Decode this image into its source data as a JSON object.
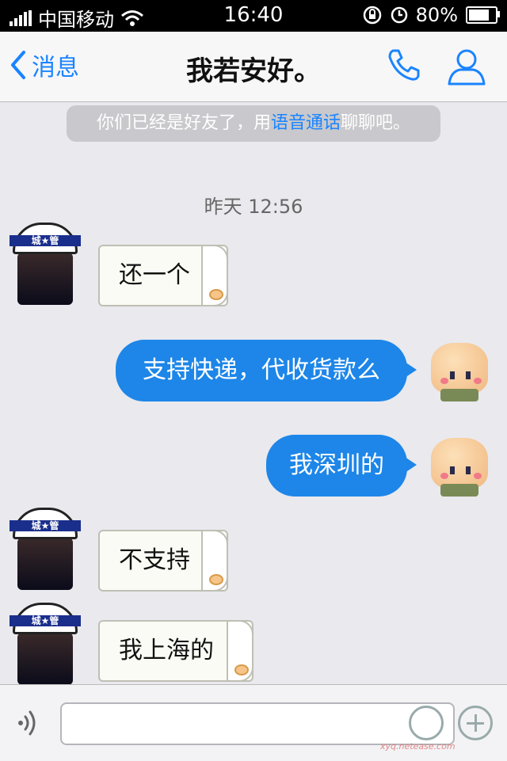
{
  "status_bar": {
    "carrier": "中国移动",
    "time": "16:40",
    "battery": "80%"
  },
  "nav": {
    "back_label": "消息",
    "title": "我若安好。"
  },
  "system_note": {
    "prefix": "你们已经是好友了，用",
    "link": "语音通话",
    "suffix": "聊聊吧。"
  },
  "timestamp": "昨天 12:56",
  "messages": [
    {
      "side": "left",
      "text": "还一个",
      "avatar_text": "城★管"
    },
    {
      "side": "right",
      "text": "支持快递，代收货款么"
    },
    {
      "side": "right",
      "text": "我深圳的"
    },
    {
      "side": "left",
      "text": "不支持",
      "avatar_text": "城★管"
    },
    {
      "side": "left",
      "text": "我上海的",
      "avatar_text": "城★管"
    }
  ],
  "input": {
    "placeholder": ""
  },
  "watermark": {
    "url": "xyq.netease.com"
  },
  "icons": [
    "back-chevron-icon",
    "phone-icon",
    "profile-icon",
    "voice-icon",
    "emoji-icon",
    "plus-icon",
    "wifi-icon",
    "lock-rotation-icon",
    "alarm-icon",
    "battery-icon"
  ],
  "colors": {
    "accent": "#1a84ff",
    "bubble_out": "#1d86e8",
    "background": "#e9e9ee"
  }
}
